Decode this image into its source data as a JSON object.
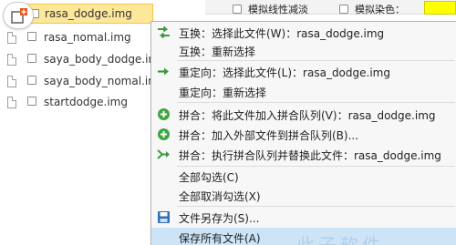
{
  "topbar": {
    "opt1_label": "模拟线性减淡",
    "opt2_label": "模拟染色：",
    "swatch_color": "#ffff00"
  },
  "file_list": {
    "items": [
      {
        "name": "rasa_dodge.img"
      },
      {
        "name": "rasa_nomal.img"
      },
      {
        "name": "saya_body_dodge.in"
      },
      {
        "name": "saya_body_nomal.im"
      },
      {
        "name": "startdodge.img"
      }
    ]
  },
  "context_menu": {
    "items": [
      {
        "label": "互换：选择此文件(W)：rasa_dodge.img",
        "icon": "swap-icon"
      },
      {
        "label": "互换：重新选择",
        "icon": ""
      },
      {
        "label": "重定向：选择此文件(L)：rasa_dodge.img",
        "icon": "arrow-right-icon"
      },
      {
        "label": "重定向：重新选择",
        "icon": ""
      },
      {
        "label": "拼合：将此文件加入拼合队列(V)：rasa_dodge.img",
        "icon": "plus-circle-icon"
      },
      {
        "label": "拼合：加入外部文件到拼合队列(B)...",
        "icon": "plus-circle-icon"
      },
      {
        "label": "拼合：执行拼合队列并替换此文件：rasa_dodge.img",
        "icon": "merge-icon"
      },
      {
        "label": "全部勾选(C)",
        "icon": ""
      },
      {
        "label": "全部取消勾选(X)",
        "icon": ""
      },
      {
        "label": "文件另存为(S)...",
        "icon": "save-icon"
      },
      {
        "label": "保存所有文件(A)",
        "icon": ""
      }
    ]
  },
  "watermark": {
    "text": "此子软件"
  }
}
